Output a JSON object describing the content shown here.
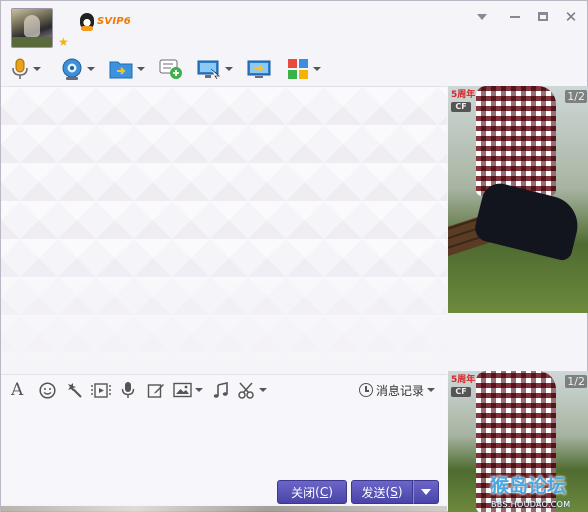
{
  "titlebar": {
    "vip_label": "SVIP6",
    "icons": {
      "avatar": "user-avatar",
      "star": "star-icon",
      "vip": "qq-penguin-icon"
    }
  },
  "toolbar": {
    "icons": [
      "microphone-icon",
      "webcam-icon",
      "send-file-icon",
      "add-chat-icon",
      "remote-desktop-icon",
      "share-screen-icon",
      "apps-grid-icon"
    ]
  },
  "photo_panel": {
    "top_page": "1/2",
    "bottom_page": "1/2",
    "logo_text": "5周年",
    "logo_sub": "CF"
  },
  "input_toolbar": {
    "icons": [
      "font-icon",
      "emoji-icon",
      "magic-icon",
      "gif-icon",
      "voice-icon",
      "edit-icon",
      "image-icon",
      "music-icon",
      "screenshot-icon"
    ],
    "history_label": "消息记录"
  },
  "buttons": {
    "close_label": "关闭",
    "close_key": "C",
    "send_label": "发送",
    "send_key": "S"
  },
  "watermark": {
    "text": "猴岛论坛",
    "sub": "BBS.HOUDAO.COM"
  },
  "colors": {
    "accent": "#4f49ae",
    "vip": "#f07a00"
  }
}
